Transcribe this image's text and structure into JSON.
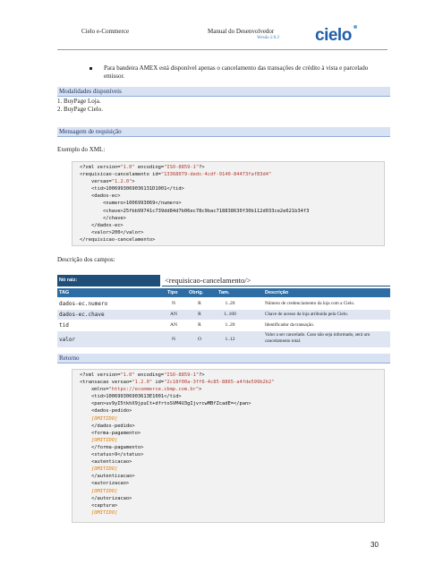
{
  "header": {
    "left": "Cielo e-Commerce",
    "center": "Manual do Desenvolvedor",
    "version": "Versão 2.0.3",
    "logo_text": "cielo"
  },
  "bullet_text": "Para bandeira AMEX está disponível apenas o cancelamento das transações de crédito à vista e parcelado emissor.",
  "section_modalidades": {
    "title": "Modalidades disponíveis",
    "items": [
      "1.  BuyPage Loja.",
      "2.  BuyPage Cielo."
    ]
  },
  "section_requisicao": {
    "title": "Mensagem de requisição",
    "example_label": "Exemplo do XML:"
  },
  "xml_request": [
    "<?xml version=\"1.0\" encoding=\"ISO-8859-1\"?>",
    "<requisicao-cancelamento id=\"13368079-dedc-4cdf-9140-84473faf83d4\"",
    "    versao=\"1.2.0\">",
    "    <tid>1006993069036131D1001</tid>",
    "    <dados-ec>",
    "        <numero>1006993069</numero>",
    "        <chave>25fbb99741c739dd84d7b06ec78c9bac718838630f30b112d033ce2e621b34f3",
    "        </chave>",
    "    </dados-ec>",
    "    <valor>200</valor>",
    "</requisicao-cancelamento>"
  ],
  "fields_label": "Descrição dos campos:",
  "fields_table": {
    "root_label": "Nó raiz:",
    "root_value": "<requisicao-cancelamento/>",
    "headers": [
      "TAG",
      "Tipo",
      "Obrig.",
      "Tam.",
      "Descrição"
    ],
    "rows": [
      {
        "tag": "dados-ec.numero",
        "tipo": "N",
        "obrig": "R",
        "tam": "1..20",
        "desc": "Número de credenciamento da loja com a Cielo."
      },
      {
        "tag": "dados-ec.chave",
        "tipo": "AN",
        "obrig": "R",
        "tam": "1..100",
        "desc": "Chave de acesso da loja atribuída pela Cielo."
      },
      {
        "tag": "tid",
        "tipo": "AN",
        "obrig": "R",
        "tam": "1..20",
        "desc": "Identificador da transação."
      },
      {
        "tag": "valor",
        "tipo": "N",
        "obrig": "O",
        "tam": "1..12",
        "desc": "Valor a ser cancelado. Caso não seja informado, será um cancelamento total."
      }
    ]
  },
  "section_retorno": {
    "title": "Retorno"
  },
  "xml_response": [
    "<?xml version=\"1.0\" encoding=\"ISO-8859-1\"?>",
    "<transacao versao=\"1.2.0\" id=\"2c18f00a-3ff6-4c85-8865-a4fde599b2b2\"",
    "    xmlns=\"https://ecommerce.cbmp.com.br\">",
    "    <tid>100699306903613E1001</tid>",
    "    <pan>uv9yI5tkhX9jpuCt+dfrtoSVM4U3gIjvrcwMBfZcadE=</pan>",
    "    <dados-pedido>",
    "    [OMITIDO]",
    "    </dados-pedido>",
    "    <forma-pagamento>",
    "    [OMITIDO]",
    "    </forma-pagamento>",
    "    <status>9</status>",
    "    <autenticacao>",
    "    [OMITIDO]",
    "    </autenticacao>",
    "    <autorizacao>",
    "    [OMITIDO]",
    "    </autorizacao>",
    "    <captura>",
    "    [OMITIDO]"
  ],
  "page_number": "30",
  "colors": {
    "heading_bg": "#d9e2f3",
    "table_header": "#2e6da4",
    "table_root": "#1f4e79",
    "logo": "#1f5fa8",
    "xml_string": "#b03a2e",
    "xml_omitted": "#e07a00"
  }
}
